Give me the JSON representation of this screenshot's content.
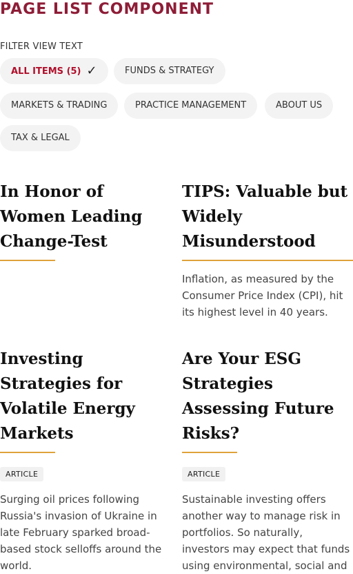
{
  "page": {
    "title": "PAGE LIST COMPONENT"
  },
  "filter": {
    "label": "FILTER VIEW TEXT",
    "chips": [
      {
        "label": "ALL ITEMS (5)",
        "active": true
      },
      {
        "label": "FUNDS & STRATEGY",
        "active": false
      },
      {
        "label": "MARKETS & TRADING",
        "active": false
      },
      {
        "label": "PRACTICE MANAGEMENT",
        "active": false
      },
      {
        "label": "ABOUT US",
        "active": false
      },
      {
        "label": "TAX & LEGAL",
        "active": false
      }
    ],
    "check_icon": "checkmark-icon"
  },
  "colors": {
    "title": "#8e1d37",
    "active_chip": "#b0102c",
    "accent_rule": "#e0a23a",
    "chip_bg": "#f3f3f3"
  },
  "cards": [
    {
      "title": "In Honor of Women Leading Change-Test",
      "tag": "",
      "excerpt": ""
    },
    {
      "title": "TIPS: Valuable but Widely Misunderstood",
      "tag": "",
      "excerpt": "Inflation, as measured by the Consumer Price Index (CPI), hit its highest level in 40 years."
    },
    {
      "title": "Investing Strategies for Volatile Energy Markets",
      "tag": "ARTICLE",
      "excerpt": "Surging oil prices following Russia's invasion of Ukraine in late February sparked broad-based stock selloffs around the world."
    },
    {
      "title": "Are Your ESG Strategies Assessing Future Risks?",
      "tag": "ARTICLE",
      "excerpt": "Sustainable investing offers another way to manage risk in portfolios. So naturally, investors may expect that funds using environmental, social and"
    }
  ]
}
